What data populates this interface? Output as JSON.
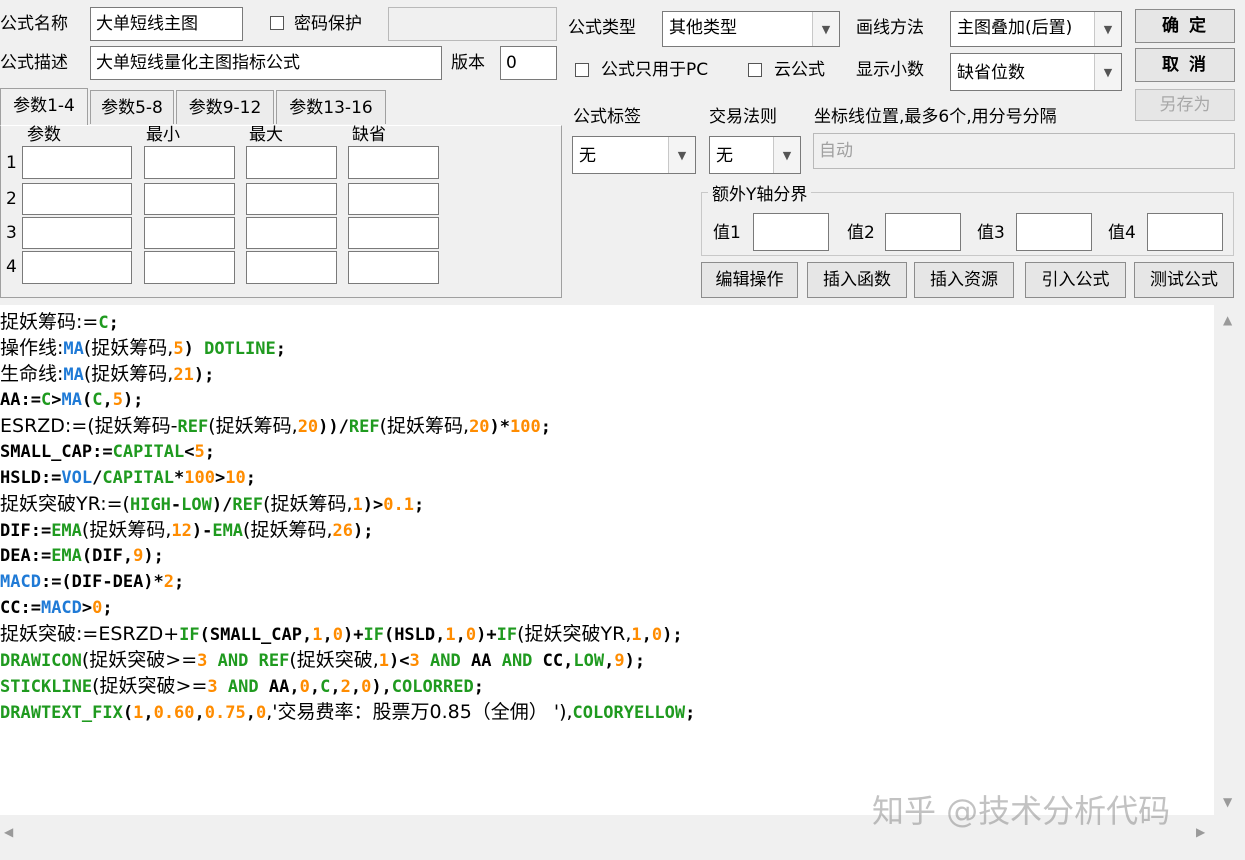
{
  "header": {
    "name_label": "公式名称",
    "name_value": "大单短线主图",
    "password_label": "密码保护",
    "password_value": "",
    "desc_label": "公式描述",
    "desc_value": "大单短线量化主图指标公式",
    "version_label": "版本",
    "version_value": "0",
    "type_label": "公式类型",
    "type_value": "其他类型",
    "draw_label": "画线方法",
    "draw_value": "主图叠加(后置)",
    "pc_only_label": "公式只用于PC",
    "cloud_label": "云公式",
    "decimal_label": "显示小数",
    "decimal_value": "缺省位数"
  },
  "buttons": {
    "ok": "确 定",
    "cancel": "取 消",
    "save_as": "另存为",
    "edit": "编辑操作",
    "insert_func": "插入函数",
    "insert_res": "插入资源",
    "import_formula": "引入公式",
    "test_formula": "测试公式"
  },
  "tabs": [
    "参数1-4",
    "参数5-8",
    "参数9-12",
    "参数13-16"
  ],
  "params": {
    "headers": [
      "参数",
      "最小",
      "最大",
      "缺省"
    ],
    "rows": [
      "1",
      "2",
      "3",
      "4"
    ]
  },
  "right": {
    "tag_label": "公式标签",
    "tag_value": "无",
    "rule_label": "交易法则",
    "rule_value": "无",
    "axis_label": "坐标线位置,最多6个,用分号分隔",
    "axis_value": "自动",
    "yaxis_legend": "额外Y轴分界",
    "v1": "值1",
    "v2": "值2",
    "v3": "值3",
    "v4": "值4"
  },
  "code_lines": [
    [
      [
        "捉妖筹码:=",
        "k"
      ],
      [
        "C",
        "g"
      ],
      [
        ";",
        "k"
      ]
    ],
    [
      [
        "操作线:",
        "k"
      ],
      [
        "MA",
        "b"
      ],
      [
        "(捉妖筹码,",
        "k"
      ],
      [
        "5",
        "o"
      ],
      [
        ") ",
        "k"
      ],
      [
        "DOTLINE",
        "g"
      ],
      [
        ";",
        "k"
      ]
    ],
    [
      [
        "生命线:",
        "k"
      ],
      [
        "MA",
        "b"
      ],
      [
        "(捉妖筹码,",
        "k"
      ],
      [
        "21",
        "o"
      ],
      [
        ");",
        "k"
      ]
    ],
    [
      [
        "AA:=",
        "k"
      ],
      [
        "C",
        "g"
      ],
      [
        ">",
        "k"
      ],
      [
        "MA",
        "b"
      ],
      [
        "(",
        "k"
      ],
      [
        "C",
        "g"
      ],
      [
        ",",
        "k"
      ],
      [
        "5",
        "o"
      ],
      [
        ");",
        "k"
      ]
    ],
    [
      [
        "ESRZD:=(捉妖筹码-",
        "k"
      ],
      [
        "REF",
        "g"
      ],
      [
        "(捉妖筹码,",
        "k"
      ],
      [
        "20",
        "o"
      ],
      [
        "))/",
        "k"
      ],
      [
        "REF",
        "g"
      ],
      [
        "(捉妖筹码,",
        "k"
      ],
      [
        "20",
        "o"
      ],
      [
        ")*",
        "k"
      ],
      [
        "100",
        "o"
      ],
      [
        ";",
        "k"
      ]
    ],
    [
      [
        "SMALL_CAP:=",
        "k"
      ],
      [
        "CAPITAL",
        "g"
      ],
      [
        "<",
        "k"
      ],
      [
        "5",
        "o"
      ],
      [
        ";",
        "k"
      ]
    ],
    [
      [
        "HSLD:=",
        "k"
      ],
      [
        "VOL",
        "b"
      ],
      [
        "/",
        "k"
      ],
      [
        "CAPITAL",
        "g"
      ],
      [
        "*",
        "k"
      ],
      [
        "100",
        "o"
      ],
      [
        ">",
        "k"
      ],
      [
        "10",
        "o"
      ],
      [
        ";",
        "k"
      ]
    ],
    [
      [
        "捉妖突破YR:=(",
        "k"
      ],
      [
        "HIGH",
        "g"
      ],
      [
        "-",
        "k"
      ],
      [
        "LOW",
        "g"
      ],
      [
        ")/",
        "k"
      ],
      [
        "REF",
        "g"
      ],
      [
        "(捉妖筹码,",
        "k"
      ],
      [
        "1",
        "o"
      ],
      [
        ")>",
        "k"
      ],
      [
        "0.1",
        "o"
      ],
      [
        ";",
        "k"
      ]
    ],
    [
      [
        "DIF:=",
        "k"
      ],
      [
        "EMA",
        "g"
      ],
      [
        "(捉妖筹码,",
        "k"
      ],
      [
        "12",
        "o"
      ],
      [
        ")-",
        "k"
      ],
      [
        "EMA",
        "g"
      ],
      [
        "(捉妖筹码,",
        "k"
      ],
      [
        "26",
        "o"
      ],
      [
        ");",
        "k"
      ]
    ],
    [
      [
        "DEA:=",
        "k"
      ],
      [
        "EMA",
        "g"
      ],
      [
        "(DIF,",
        "k"
      ],
      [
        "9",
        "o"
      ],
      [
        ");",
        "k"
      ]
    ],
    [
      [
        "MACD",
        "b"
      ],
      [
        ":=(DIF-DEA)*",
        "k"
      ],
      [
        "2",
        "o"
      ],
      [
        ";",
        "k"
      ]
    ],
    [
      [
        "CC:=",
        "k"
      ],
      [
        "MACD",
        "b"
      ],
      [
        ">",
        "k"
      ],
      [
        "0",
        "o"
      ],
      [
        ";",
        "k"
      ]
    ],
    [
      [
        "捉妖突破:=ESRZD+",
        "k"
      ],
      [
        "IF",
        "g"
      ],
      [
        "(SMALL_CAP,",
        "k"
      ],
      [
        "1",
        "o"
      ],
      [
        ",",
        "k"
      ],
      [
        "0",
        "o"
      ],
      [
        ")+",
        "k"
      ],
      [
        "IF",
        "g"
      ],
      [
        "(HSLD,",
        "k"
      ],
      [
        "1",
        "o"
      ],
      [
        ",",
        "k"
      ],
      [
        "0",
        "o"
      ],
      [
        ")+",
        "k"
      ],
      [
        "IF",
        "g"
      ],
      [
        "(捉妖突破YR,",
        "k"
      ],
      [
        "1",
        "o"
      ],
      [
        ",",
        "k"
      ],
      [
        "0",
        "o"
      ],
      [
        ");",
        "k"
      ]
    ],
    [
      [
        "DRAWICON",
        "g"
      ],
      [
        "(捉妖突破>=",
        "k"
      ],
      [
        "3",
        "o"
      ],
      [
        " ",
        "k"
      ],
      [
        "AND",
        "g"
      ],
      [
        " ",
        "k"
      ],
      [
        "REF",
        "g"
      ],
      [
        "(捉妖突破,",
        "k"
      ],
      [
        "1",
        "o"
      ],
      [
        ")<",
        "k"
      ],
      [
        "3",
        "o"
      ],
      [
        " ",
        "k"
      ],
      [
        "AND",
        "g"
      ],
      [
        " AA ",
        "k"
      ],
      [
        "AND",
        "g"
      ],
      [
        " CC,",
        "k"
      ],
      [
        "LOW",
        "g"
      ],
      [
        ",",
        "k"
      ],
      [
        "9",
        "o"
      ],
      [
        ");",
        "k"
      ]
    ],
    [
      [
        "STICKLINE",
        "g"
      ],
      [
        "(捉妖突破>=",
        "k"
      ],
      [
        "3",
        "o"
      ],
      [
        " ",
        "k"
      ],
      [
        "AND",
        "g"
      ],
      [
        " AA,",
        "k"
      ],
      [
        "0",
        "o"
      ],
      [
        ",",
        "k"
      ],
      [
        "C",
        "g"
      ],
      [
        ",",
        "k"
      ],
      [
        "2",
        "o"
      ],
      [
        ",",
        "k"
      ],
      [
        "0",
        "o"
      ],
      [
        "),",
        "k"
      ],
      [
        "COLORRED",
        "g"
      ],
      [
        ";",
        "k"
      ]
    ],
    [
      [
        "DRAWTEXT_FIX",
        "g"
      ],
      [
        "(",
        "k"
      ],
      [
        "1",
        "o"
      ],
      [
        ",",
        "k"
      ],
      [
        "0.60",
        "o"
      ],
      [
        ",",
        "k"
      ],
      [
        "0.75",
        "o"
      ],
      [
        ",",
        "k"
      ],
      [
        "0",
        "o"
      ],
      [
        ",'交易费率：股票万0.85（全佣） '),",
        "k"
      ],
      [
        "COLORYELLOW",
        "g"
      ],
      [
        ";",
        "k"
      ]
    ]
  ],
  "colors": {
    "k": "#000000",
    "g": "#1f9a1f",
    "b": "#1f7ad6",
    "o": "#ff8c00"
  },
  "watermark": "知乎 @技术分析代码"
}
